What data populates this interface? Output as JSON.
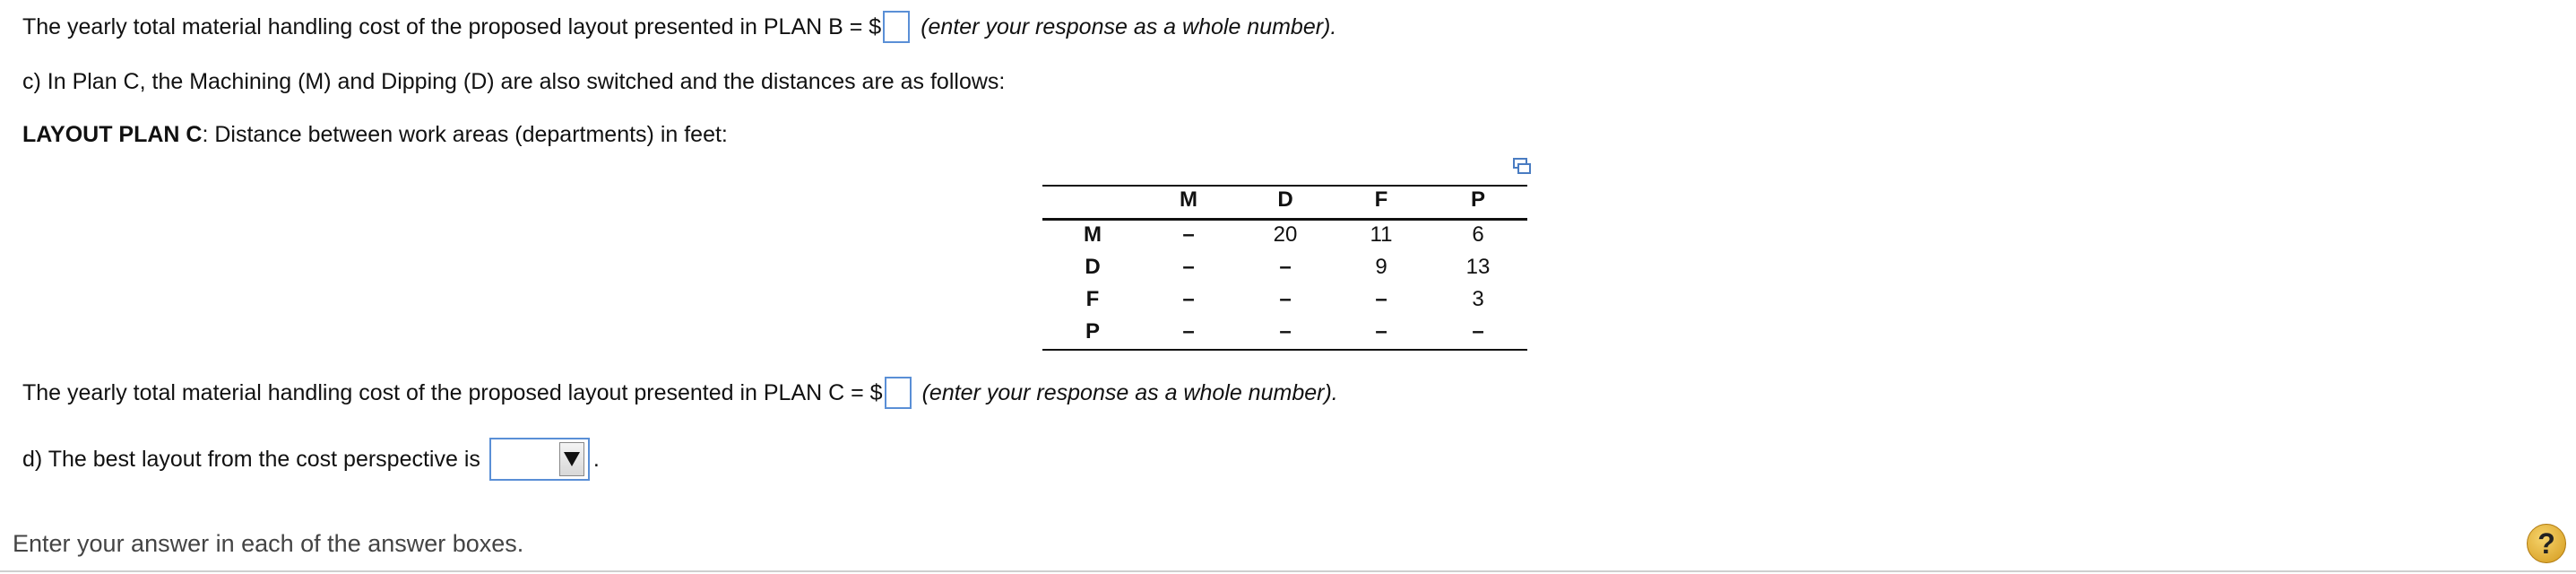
{
  "plan_b": {
    "prefix": "The yearly total material handling cost of the proposed layout presented in PLAN B = $",
    "hint": "(enter your response as a whole number)."
  },
  "part_c": {
    "text": "c) In Plan C, the Machining (M) and Dipping (D) are also switched and the distances are as follows:"
  },
  "layout_c": {
    "label": "LAYOUT PLAN C",
    "rest": ": Distance between work areas (departments) in feet:"
  },
  "table": {
    "columns": [
      "M",
      "D",
      "F",
      "P"
    ],
    "rows": [
      {
        "label": "M",
        "cells": [
          "–",
          "20",
          "11",
          "6"
        ]
      },
      {
        "label": "D",
        "cells": [
          "–",
          "–",
          "9",
          "13"
        ]
      },
      {
        "label": "F",
        "cells": [
          "–",
          "–",
          "–",
          "3"
        ]
      },
      {
        "label": "P",
        "cells": [
          "–",
          "–",
          "–",
          "–"
        ]
      }
    ]
  },
  "plan_c": {
    "prefix": "The yearly total material handling cost of the proposed layout presented in PLAN C = $",
    "hint": "(enter your response as a whole number)."
  },
  "part_d": {
    "prefix": "d) The best layout from the cost perspective is",
    "suffix": "."
  },
  "footer": {
    "text": "Enter your answer in each of the answer boxes."
  },
  "help": {
    "label": "?"
  },
  "icons": {
    "copy": "copy-table-icon",
    "help": "help-icon",
    "dropdown": "chevron-down-icon"
  },
  "colors": {
    "input_border": "#5a8fd6",
    "help_bg": "#e0b040"
  }
}
